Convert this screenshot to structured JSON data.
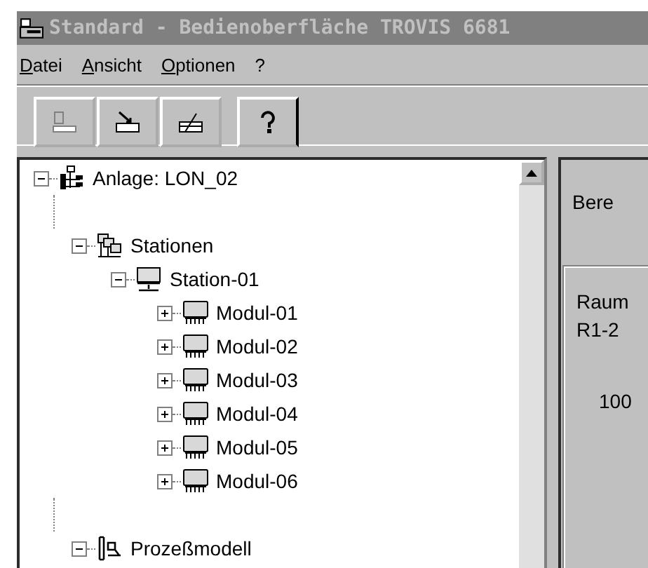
{
  "window": {
    "title": "Standard - Bedienoberfläche TROVIS 6681"
  },
  "menu": [
    {
      "label": "Datei"
    },
    {
      "label": "Ansicht"
    },
    {
      "label": "Optionen"
    },
    {
      "label": "?"
    }
  ],
  "toolbar": [
    {
      "kind": "connect",
      "disabled": true
    },
    {
      "kind": "import",
      "disabled": false
    },
    {
      "kind": "export",
      "disabled": false
    },
    {
      "kind": "help",
      "disabled": false
    }
  ],
  "tree": [
    {
      "label": "Anlage: LON_02",
      "kind": "plant",
      "expanded": true,
      "children": [
        {
          "label": "Stationen",
          "kind": "stations",
          "expanded": true,
          "children": [
            {
              "label": "Station-01",
              "kind": "station",
              "expanded": true,
              "children": [
                {
                  "label": "Modul-01",
                  "kind": "module",
                  "expanded": false
                },
                {
                  "label": "Modul-02",
                  "kind": "module",
                  "expanded": false
                },
                {
                  "label": "Modul-03",
                  "kind": "module",
                  "expanded": false
                },
                {
                  "label": "Modul-04",
                  "kind": "module",
                  "expanded": false
                },
                {
                  "label": "Modul-05",
                  "kind": "module",
                  "expanded": false
                },
                {
                  "label": "Modul-06",
                  "kind": "module",
                  "expanded": false
                }
              ]
            }
          ]
        },
        {
          "label": "Prozeßmodell",
          "kind": "model",
          "expanded": true
        }
      ]
    }
  ],
  "detail": {
    "heading": "Bere",
    "group": {
      "line_1": "Raum",
      "line_2": "R1-2",
      "value": "100"
    }
  }
}
